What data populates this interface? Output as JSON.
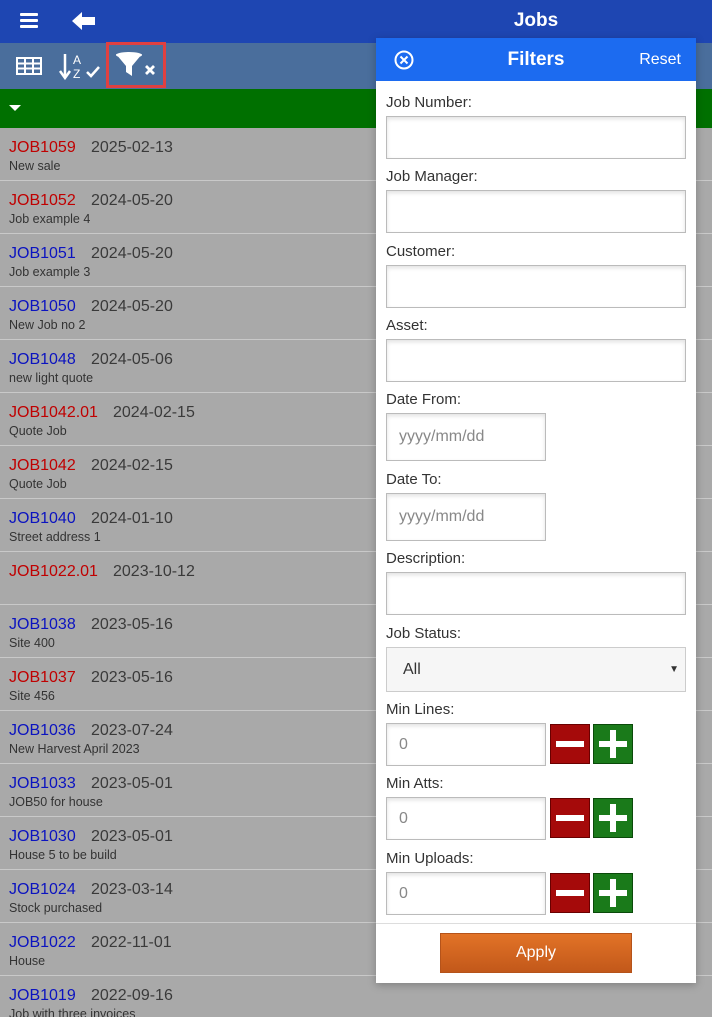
{
  "header": {
    "title": "Jobs"
  },
  "colors": {
    "header_bg": "#1e46b2",
    "toolbar_bg": "#4a6e9c",
    "green_band": "#007000",
    "panel_header": "#1c6bf0",
    "apply": "#d9661f",
    "job_red": "#c00000",
    "job_blue": "#0b13c0"
  },
  "icons": {
    "menu": "hamburger-icon",
    "back": "arrow-left-icon",
    "grid": "table-icon",
    "sort": "sort-az-icon",
    "filter_clear": "filter-clear-icon",
    "dropdown": "caret-down-icon",
    "close": "close-circle-icon"
  },
  "jobs": [
    {
      "number": "JOB1059",
      "date": "2025-02-13",
      "desc": "New sale",
      "color": "red"
    },
    {
      "number": "JOB1052",
      "date": "2024-05-20",
      "desc": "Job example 4",
      "color": "red"
    },
    {
      "number": "JOB1051",
      "date": "2024-05-20",
      "desc": "Job example 3",
      "color": "blue"
    },
    {
      "number": "JOB1050",
      "date": "2024-05-20",
      "desc": "New Job no 2",
      "color": "blue"
    },
    {
      "number": "JOB1048",
      "date": "2024-05-06",
      "desc": "new light quote",
      "color": "blue"
    },
    {
      "number": "JOB1042.01",
      "date": "2024-02-15",
      "desc": "Quote Job",
      "color": "red"
    },
    {
      "number": "JOB1042",
      "date": "2024-02-15",
      "desc": "Quote Job",
      "color": "red"
    },
    {
      "number": "JOB1040",
      "date": "2024-01-10",
      "desc": "Street address 1",
      "color": "blue"
    },
    {
      "number": "JOB1022.01",
      "date": "2023-10-12",
      "desc": "",
      "color": "red"
    },
    {
      "number": "JOB1038",
      "date": "2023-05-16",
      "desc": "Site 400",
      "color": "blue"
    },
    {
      "number": "JOB1037",
      "date": "2023-05-16",
      "desc": "Site 456",
      "color": "red"
    },
    {
      "number": "JOB1036",
      "date": "2023-07-24",
      "desc": "New Harvest April 2023",
      "color": "blue"
    },
    {
      "number": "JOB1033",
      "date": "2023-05-01",
      "desc": "JOB50 for house",
      "color": "blue"
    },
    {
      "number": "JOB1030",
      "date": "2023-05-01",
      "desc": "House 5 to be build",
      "color": "blue"
    },
    {
      "number": "JOB1024",
      "date": "2023-03-14",
      "desc": "Stock purchased",
      "color": "blue"
    },
    {
      "number": "JOB1022",
      "date": "2022-11-01",
      "desc": "House",
      "color": "blue"
    },
    {
      "number": "JOB1019",
      "date": "2022-09-16",
      "desc": "Job with three invoices",
      "color": "blue"
    }
  ],
  "filters": {
    "title": "Filters",
    "reset": "Reset",
    "job_number": {
      "label": "Job Number:",
      "value": ""
    },
    "job_manager": {
      "label": "Job Manager:",
      "value": ""
    },
    "customer": {
      "label": "Customer:",
      "value": ""
    },
    "asset": {
      "label": "Asset:",
      "value": ""
    },
    "date_from": {
      "label": "Date From:",
      "placeholder": "yyyy/mm/dd"
    },
    "date_to": {
      "label": "Date To:",
      "placeholder": "yyyy/mm/dd"
    },
    "description": {
      "label": "Description:",
      "value": ""
    },
    "job_status": {
      "label": "Job Status:",
      "value": "All"
    },
    "min_lines": {
      "label": "Min Lines:",
      "value": "0"
    },
    "min_atts": {
      "label": "Min Atts:",
      "value": "0"
    },
    "min_uploads": {
      "label": "Min Uploads:",
      "value": "0"
    },
    "apply": "Apply"
  }
}
